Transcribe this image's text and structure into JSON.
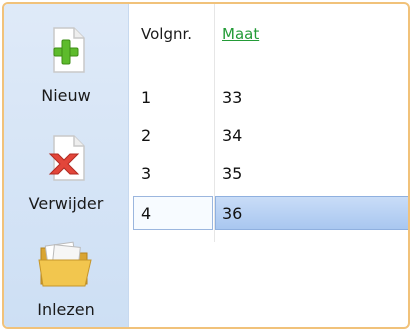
{
  "toolbar": {
    "new_label": "Nieuw",
    "delete_label": "Verwijder",
    "import_label": "Inlezen"
  },
  "table": {
    "columns": [
      "Volgnr.",
      "Maat"
    ],
    "rows": [
      {
        "volgnr": "1",
        "maat": "33"
      },
      {
        "volgnr": "2",
        "maat": "34"
      },
      {
        "volgnr": "3",
        "maat": "35"
      },
      {
        "volgnr": "4",
        "maat": "36"
      }
    ],
    "selected_row_index": 3
  },
  "colors": {
    "frame_border": "#f1c27a",
    "toolbar_bg": "#dfeaf8",
    "link_header": "#239b37",
    "selection": "#a9c7f0"
  }
}
